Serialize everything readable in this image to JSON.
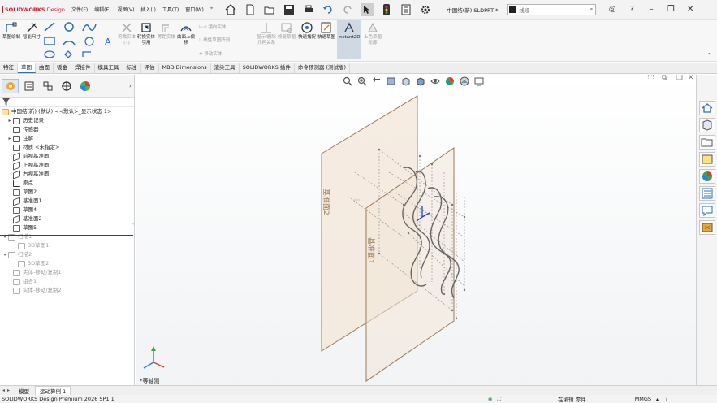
{
  "app": {
    "brand": "SOLIDWORKS",
    "brand_suffix": "Design",
    "document_name": "中国结(新).SLDPRT *",
    "search_placeholder": "线段"
  },
  "menus": [
    "文件(F)",
    "编辑(E)",
    "视图(V)",
    "插入(I)",
    "工具(T)",
    "窗口(W)"
  ],
  "ribbon": {
    "sketch": "草图绘制",
    "smart_dim": "智能尺寸",
    "trim": "剪裁实体(T)",
    "convert": "转换实体引用",
    "offset": "等距实体",
    "surface_offset": "曲面上偏移",
    "mirror": "镜向实体",
    "linear_pattern": "线性草图阵列",
    "move": "移动实体",
    "display_relations": "显示/删除几何关系",
    "repair": "修复草图",
    "quick_snap": "快速捕捉",
    "rapid_sketch": "快速草图",
    "instant2d": "Instant2D",
    "shaded_contours": "上色草图轮廓"
  },
  "tabs": [
    "特征",
    "草图",
    "曲面",
    "钣金",
    "焊接件",
    "模具工具",
    "标注",
    "评估",
    "MBD Dimensions",
    "渲染工具",
    "SOLIDWORKS 插件",
    "命令预测器 (测试版)"
  ],
  "active_tab": "草图",
  "tree": {
    "root": "中国结(新) (默认) <<默认>_显示状态 1>",
    "items": [
      {
        "label": "历史记录",
        "exp": "▸",
        "gray": false
      },
      {
        "label": "传感器",
        "exp": "",
        "gray": false
      },
      {
        "label": "注解",
        "exp": "▸",
        "gray": false
      },
      {
        "label": "材质 <未指定>",
        "exp": "",
        "gray": false
      },
      {
        "label": "前视基准面",
        "exp": "",
        "gray": false
      },
      {
        "label": "上视基准面",
        "exp": "",
        "gray": false
      },
      {
        "label": "右视基准面",
        "exp": "",
        "gray": false
      },
      {
        "label": "原点",
        "exp": "",
        "gray": false
      },
      {
        "label": "草图2",
        "exp": "",
        "gray": false
      },
      {
        "label": "基准面1",
        "exp": "",
        "gray": false
      },
      {
        "label": "草图4",
        "exp": "",
        "gray": false
      },
      {
        "label": "基准面2",
        "exp": "",
        "gray": false
      },
      {
        "label": "草图5",
        "exp": "",
        "gray": false
      },
      {
        "label": "扫描1",
        "exp": "▾",
        "gray": true
      },
      {
        "label": "3D草图1",
        "exp": "",
        "gray": true
      },
      {
        "label": "扫描2",
        "exp": "▾",
        "gray": true
      },
      {
        "label": "3D草图2",
        "exp": "",
        "gray": true
      },
      {
        "label": "实体-移动/复制1",
        "exp": "",
        "gray": true
      },
      {
        "label": "组合1",
        "exp": "",
        "gray": true
      },
      {
        "label": "实体-移动/复制2",
        "exp": "",
        "gray": true
      }
    ]
  },
  "graphics": {
    "plane1_label": "基准面2",
    "plane2_label": "基准面1",
    "view_label": "*等轴测"
  },
  "bottom_tabs": [
    "模型",
    "运动算例 1"
  ],
  "status": {
    "product": "SOLIDWORKS Design Premium 2026 SP1.1",
    "mode": "在编辑 零件",
    "units": "MMGS"
  },
  "colors": {
    "accent": "#2c6db9",
    "plane_fill": "#f3e6d8",
    "plane_edge": "#9c7a5a"
  }
}
